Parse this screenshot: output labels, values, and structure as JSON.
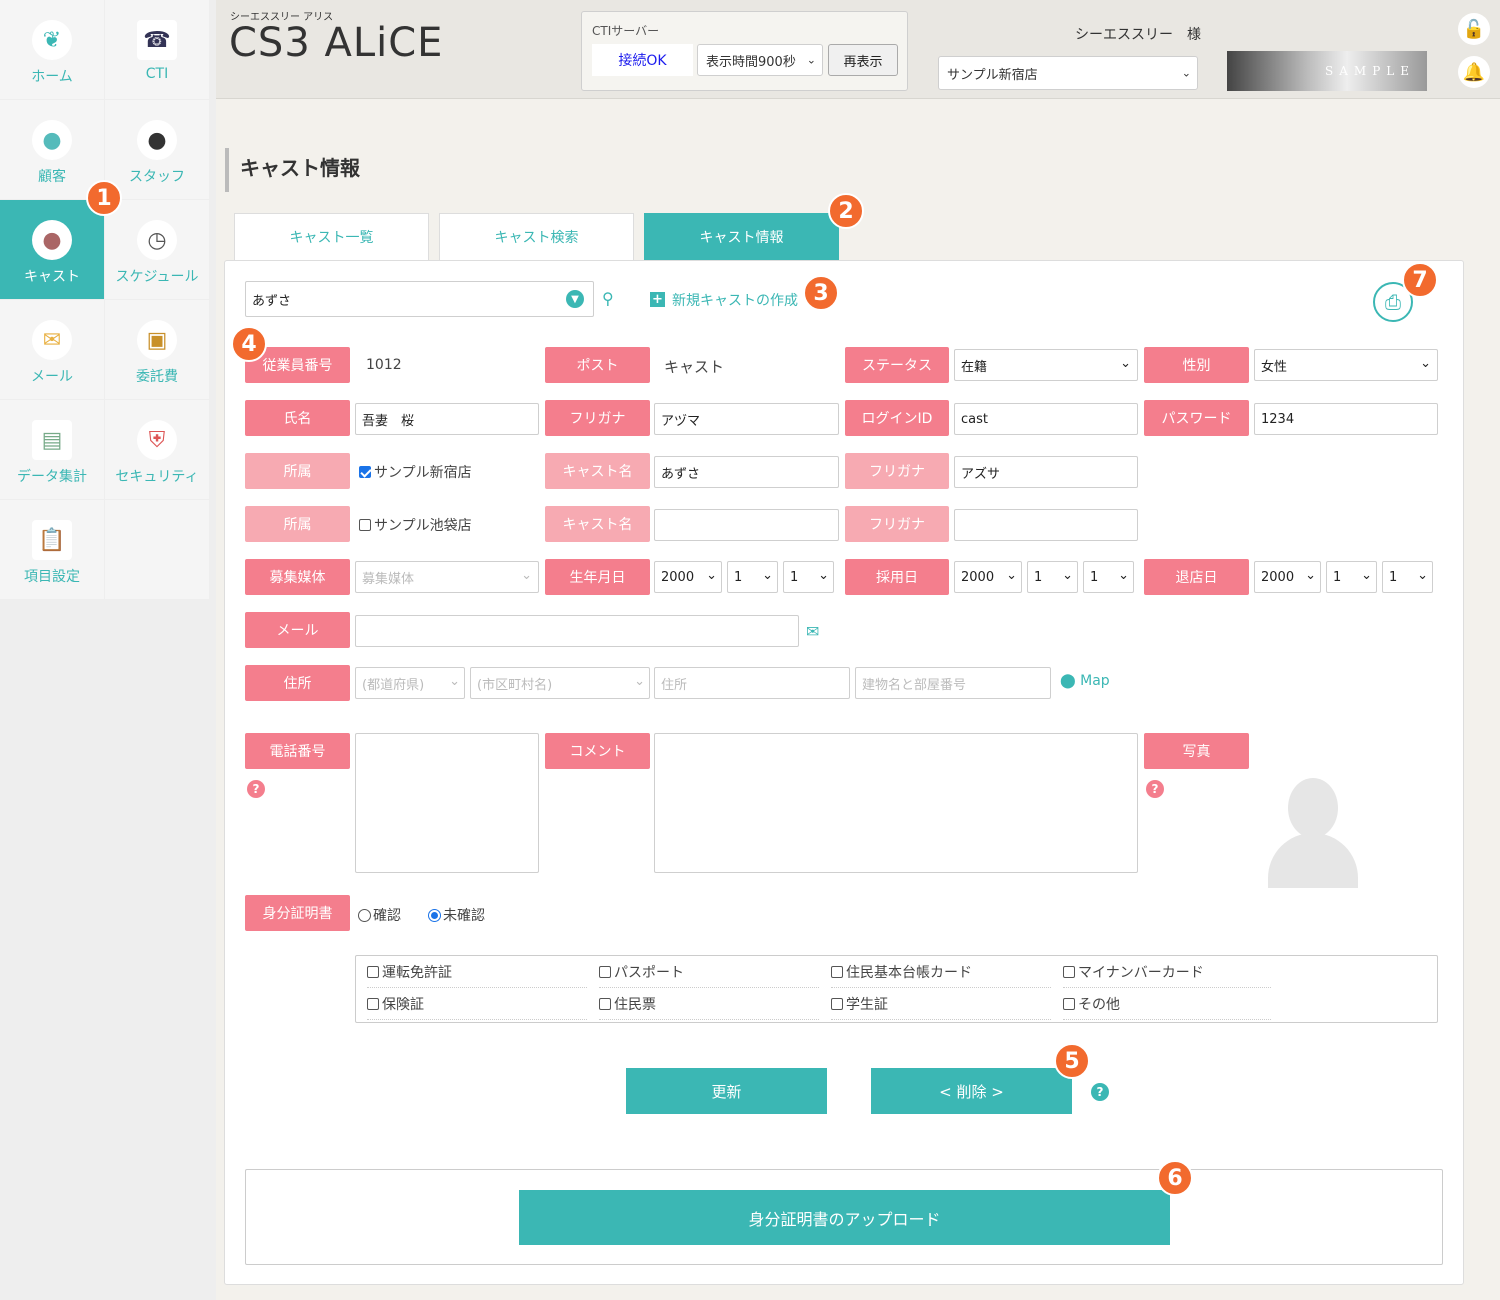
{
  "app": {
    "subtitle": "シーエススリー アリス",
    "title": "CS3 ALiCE"
  },
  "sidebar": {
    "items": [
      {
        "label": "ホーム",
        "icon": "home-icon"
      },
      {
        "label": "CTI",
        "icon": "phone-icon"
      },
      {
        "label": "顧客",
        "icon": "customer-icon"
      },
      {
        "label": "スタッフ",
        "icon": "staff-icon"
      },
      {
        "label": "キャスト",
        "icon": "cast-icon"
      },
      {
        "label": "スケジュール",
        "icon": "clock-icon"
      },
      {
        "label": "メール",
        "icon": "mail-icon"
      },
      {
        "label": "委託費",
        "icon": "wallet-icon"
      },
      {
        "label": "データ集計",
        "icon": "chart-icon"
      },
      {
        "label": "セキュリティ",
        "icon": "shield-icon"
      },
      {
        "label": "項目設定",
        "icon": "clipboard-icon"
      }
    ]
  },
  "cti": {
    "title": "CTIサーバー",
    "status": "接続OK",
    "display_time": "表示時間900秒",
    "refresh": "再表示"
  },
  "user": {
    "name": "シーエススリー　様",
    "store": "サンプル新宿店",
    "banner": "SAMPLE"
  },
  "page": {
    "title": "キャスト情報"
  },
  "tabs": [
    {
      "label": "キャスト一覧"
    },
    {
      "label": "キャスト検索"
    },
    {
      "label": "キャスト情報"
    }
  ],
  "search": {
    "value": "あずさ",
    "new_cast": "新規キャストの作成"
  },
  "badges": [
    "1",
    "2",
    "3",
    "4",
    "5",
    "6",
    "7"
  ],
  "form": {
    "employee_no_label": "従業員番号",
    "employee_no": "1012",
    "post_label": "ポスト",
    "post": "キャスト",
    "status_label": "ステータス",
    "status": "在籍",
    "gender_label": "性別",
    "gender": "女性",
    "name_label": "氏名",
    "name": "吾妻　桜",
    "furigana_label": "フリガナ",
    "furigana": "アヅマ",
    "login_label": "ログインID",
    "login": "cast",
    "password_label": "パスワード",
    "password": "1234",
    "affil_label": "所属",
    "affil1": "サンプル新宿店",
    "affil2": "サンプル池袋店",
    "castname_label": "キャスト名",
    "castname1": "あずさ",
    "castname2": "",
    "castkana_label": "フリガナ",
    "castkana1": "アズサ",
    "castkana2": "",
    "media_label": "募集媒体",
    "media_placeholder": "募集媒体",
    "birth_label": "生年月日",
    "birth_year": "2000",
    "birth_month": "1",
    "birth_day": "1",
    "hire_label": "採用日",
    "hire_year": "2000",
    "hire_month": "1",
    "hire_day": "1",
    "leave_label": "退店日",
    "leave_year": "2000",
    "leave_month": "1",
    "leave_day": "1",
    "mail_label": "メール",
    "address_label": "住所",
    "pref_ph": "(都道府県)",
    "city_ph": "(市区町村名)",
    "addr_ph": "住所",
    "bldg_ph": "建物名と部屋番号",
    "map": "Map",
    "phone_label": "電話番号",
    "comment_label": "コメント",
    "photo_label": "写真",
    "id_label": "身分証明書",
    "id_confirmed": "確認",
    "id_unconfirmed": "未確認",
    "id_types": [
      "運転免許証",
      "パスポート",
      "住民基本台帳カード",
      "マイナンバーカード",
      "保険証",
      "住民票",
      "学生証",
      "その他"
    ],
    "update": "更新",
    "delete": "< 削除 >",
    "upload": "身分証明書のアップロード"
  },
  "colors": {
    "teal": "#3bb7b4",
    "pink": "#f47e8d",
    "badge": "#f26a2e"
  }
}
